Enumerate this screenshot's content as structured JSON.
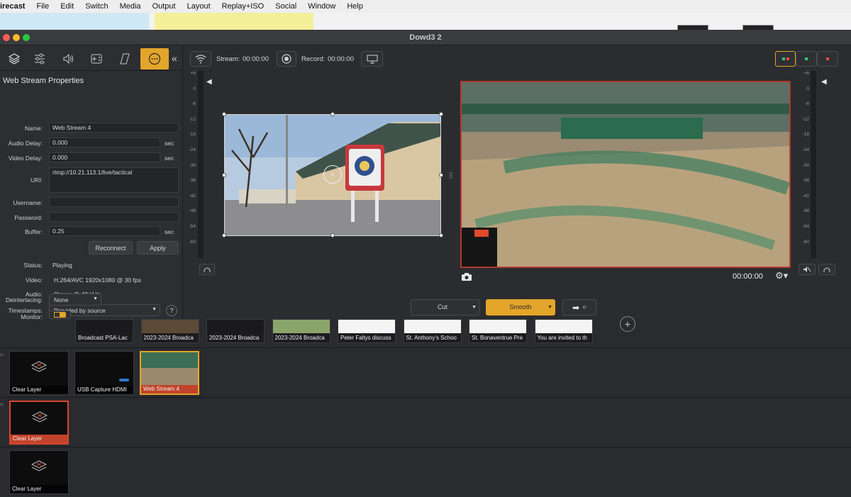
{
  "menubar": {
    "app_name": "irecast",
    "items": [
      "File",
      "Edit",
      "Switch",
      "Media",
      "Output",
      "Layout",
      "Replay+ISO",
      "Social",
      "Window",
      "Help"
    ]
  },
  "window": {
    "title": "Dowd3 2"
  },
  "inspector": {
    "tab_icons": [
      "layers-icon",
      "sliders-icon",
      "audio-icon",
      "gamepad-icon",
      "rectangle-icon",
      "more-icon"
    ],
    "collapse_glyph": "«",
    "title": "Web Stream Properties",
    "fields": {
      "name_label": "Name:",
      "name_value": "Web Stream 4",
      "audio_delay_label": "Audio Delay:",
      "audio_delay_value": "0.000",
      "audio_delay_unit": "sec",
      "video_delay_label": "Video Delay:",
      "video_delay_value": "0.000",
      "video_delay_unit": "sec",
      "uri_label": "URI:",
      "uri_value": "rtmp://10.21.113.1/live/tactical",
      "username_label": "Username:",
      "username_value": "",
      "password_label": "Password:",
      "password_value": "",
      "buffer_label": "Buffer:",
      "buffer_value": "0.25",
      "buffer_unit": "sec"
    },
    "buttons": {
      "reconnect": "Reconnect",
      "apply": "Apply"
    },
    "status": {
      "status_label": "Status:",
      "status_value": "Playing",
      "video_label": "Video:",
      "video_value": "H.264/AVC 1920x1080 @ 30 fps",
      "audio_label": "Audio:",
      "audio_value": "Stereo @ 48 kHz"
    },
    "timestamps_label": "Timestamps:",
    "timestamps_value": "Provided by source",
    "help_glyph": "?",
    "deinterlacing_label": "Deinterlacing:",
    "deinterlacing_value": "None",
    "monitor_label": "Monitor:"
  },
  "toolbar": {
    "stream_label": "Stream:",
    "stream_time": "00:00:00",
    "record_label": "Record:",
    "record_time": "00:00:00"
  },
  "meters": {
    "scale": [
      "+6",
      "0",
      "-6",
      "-12",
      "-18",
      "-24",
      "-30",
      "-36",
      "-42",
      "-48",
      "-54",
      "-60"
    ]
  },
  "program": {
    "timecode": "00:00:00"
  },
  "transition": {
    "type": "Cut",
    "mode": "Smooth",
    "arrow": "➡",
    "circle": "○"
  },
  "media_bin": [
    "Broadcast PSA-Lac",
    "2023-2024 Broadca",
    "2023-2024 Broadca",
    "2023-2024 Broadca",
    "Peter Faltys discuss",
    "St. Anthony's Schoo",
    "St. Bonaventrue Pre",
    "You are invited to th"
  ],
  "layers": [
    {
      "shots": [
        {
          "label": "Clear Layer",
          "state": "normal"
        },
        {
          "label": "USB Capture HDMI",
          "state": "normal"
        },
        {
          "label": "Web Stream 4",
          "state": "selected"
        }
      ]
    },
    {
      "shots": [
        {
          "label": "Clear Layer",
          "state": "live"
        }
      ]
    },
    {
      "shots": [
        {
          "label": "Clear Layer",
          "state": "normal"
        }
      ]
    }
  ],
  "colors": {
    "accent": "#e3a52a",
    "live": "#d9452e"
  }
}
